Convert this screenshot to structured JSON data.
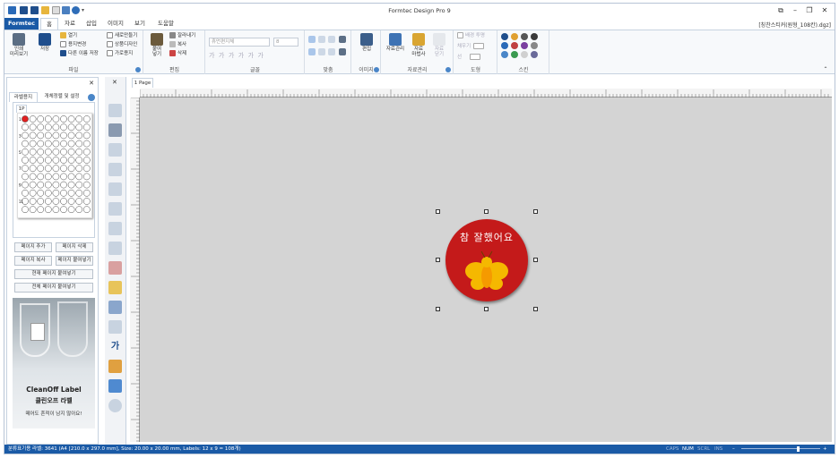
{
  "window": {
    "title": "Formtec Design Pro 9",
    "filename": "[칭찬스티커(원형_108칸).dgz]",
    "controls": [
      "⧉",
      "–",
      "❐",
      "✕"
    ]
  },
  "tabs": [
    {
      "label": "Formtec"
    },
    {
      "label": "홈"
    },
    {
      "label": "자료"
    },
    {
      "label": "삽입"
    },
    {
      "label": "이미지"
    },
    {
      "label": "보기"
    },
    {
      "label": "도움말"
    }
  ],
  "ribbon": {
    "file": {
      "label": "파일",
      "print": "인쇄\n미리보기",
      "save": "저장",
      "open": "열기",
      "change_paper": "용지변경",
      "save_as": "다른 이름 저장",
      "new": "새로만들기",
      "product_design": "상품디자인",
      "landscape": "가로용지"
    },
    "edit": {
      "label": "편집",
      "paste": "붙여\n넣기",
      "cut": "잘라내기",
      "copy": "복사",
      "delete": "삭제"
    },
    "font": {
      "label": "글꼴",
      "font_name": "휴먼편지체",
      "font_size": "8",
      "styles": [
        "가",
        "가",
        "가",
        "가",
        "가",
        "가"
      ]
    },
    "align": {
      "label": "맞춤"
    },
    "image": {
      "label": "이미지",
      "edit": "편집"
    },
    "data": {
      "label": "자료관리",
      "manage": "자료관리",
      "wizard": "자료\n마법사",
      "close": "자료\n닫기"
    },
    "shape": {
      "label": "도형",
      "bg_transparent": "배경 투명",
      "fill": "채우기",
      "line": "선"
    },
    "skin": {
      "label": "스킨"
    }
  },
  "left_panel": {
    "tabs": [
      "라벨용지",
      "개체정렬 및 설정"
    ],
    "page_tab": "1P",
    "add_page": "페이지 추가",
    "delete_page": "페이지 삭제",
    "copy_page": "페이지 복사",
    "paste_page": "페이지 붙여넣기",
    "paste_current": "현재 페이지 붙여넣기",
    "paste_all": "전체 페이지 붙여넣기",
    "grid_rows": 12,
    "grid_cols": 9,
    "row_numbers": [
      "1",
      "",
      "3",
      "",
      "5",
      "",
      "7",
      "",
      "9",
      "",
      "11",
      ""
    ],
    "ad": {
      "brand": "CleanOff Label",
      "korean": "클린오프 라벨",
      "tagline": "떼어도 흔적이 남지 않아요!"
    }
  },
  "canvas": {
    "page_tab": "1 Page",
    "sticker_text": "참 잘했어요",
    "sticker_color": "#c41a1a",
    "bee_color": "#f5b800"
  },
  "status": {
    "text": "분류표기용 라벨: 3641 (A4 [210.0 x 297.0 mm], Size: 20.00 x 20.00 mm, Labels: 12 x 9 = 108개)",
    "caps": "CAPS",
    "num": "NUM",
    "scrl": "SCRL",
    "ins": "INS"
  }
}
